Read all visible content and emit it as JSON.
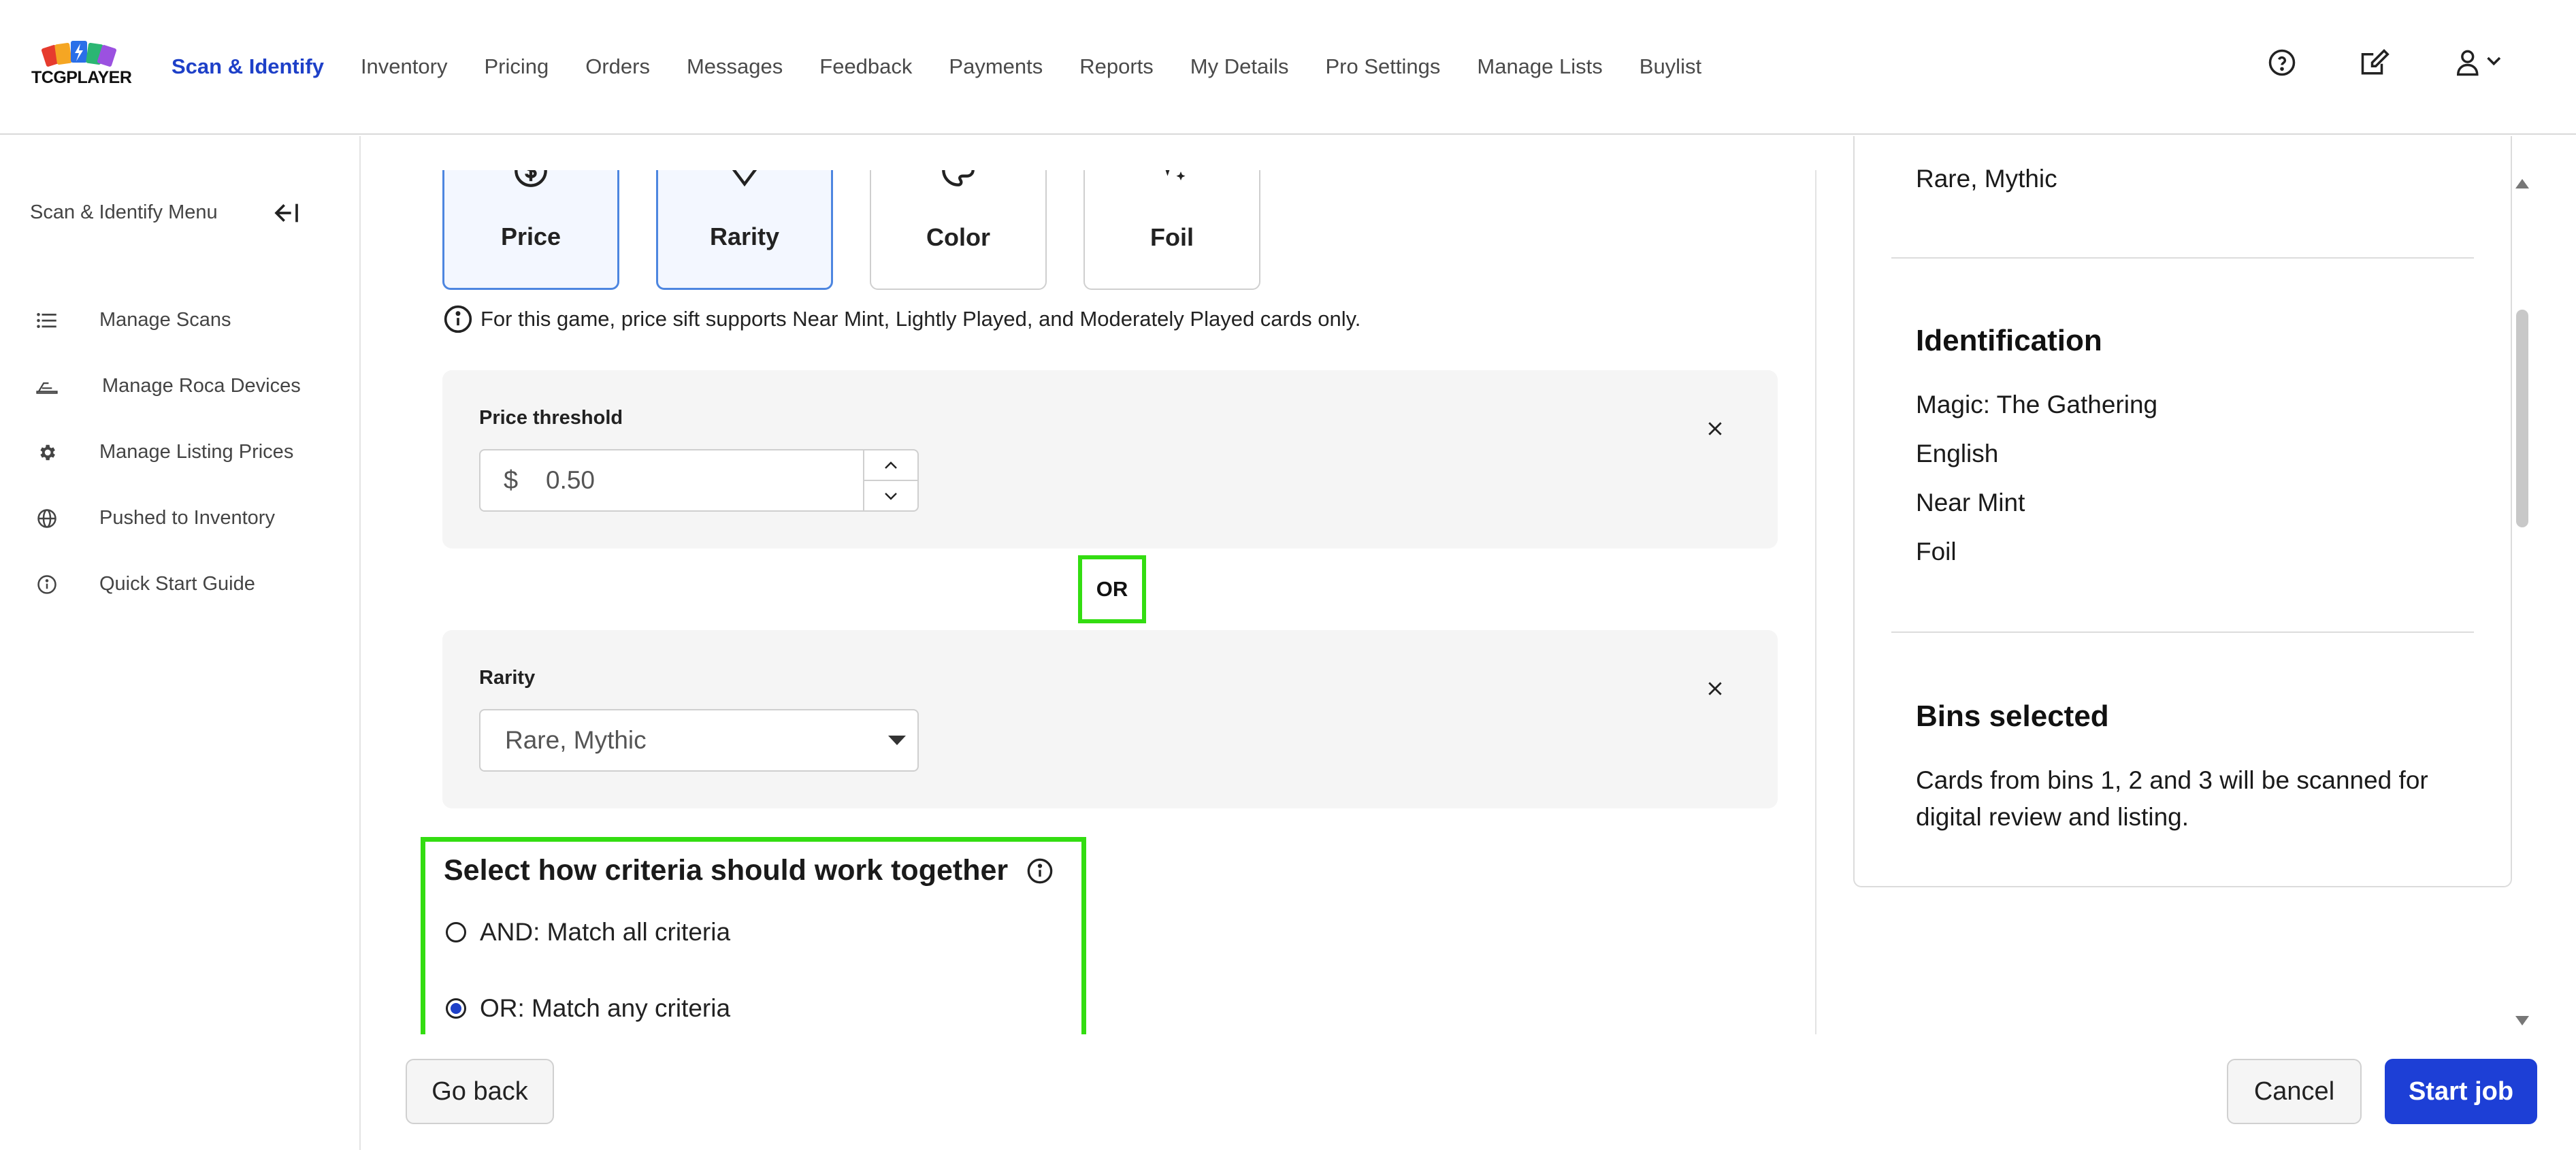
{
  "brand": {
    "name": "TCGPLAYER"
  },
  "nav": {
    "items": [
      {
        "label": "Scan & Identify",
        "active": true
      },
      {
        "label": "Inventory"
      },
      {
        "label": "Pricing"
      },
      {
        "label": "Orders"
      },
      {
        "label": "Messages"
      },
      {
        "label": "Feedback"
      },
      {
        "label": "Payments"
      },
      {
        "label": "Reports"
      },
      {
        "label": "My Details"
      },
      {
        "label": "Pro Settings"
      },
      {
        "label": "Manage Lists"
      },
      {
        "label": "Buylist"
      }
    ],
    "icons": [
      "help-circle-icon",
      "edit-note-icon",
      "user-account-icon"
    ]
  },
  "sidebar": {
    "title": "Scan & Identify Menu",
    "items": [
      {
        "label": "Manage Scans",
        "icon": "list-icon"
      },
      {
        "label": "Manage Roca Devices",
        "icon": "scanner-device-icon"
      },
      {
        "label": "Manage Listing Prices",
        "icon": "gear-icon"
      },
      {
        "label": "Pushed to Inventory",
        "icon": "globe-icon"
      },
      {
        "label": "Quick Start Guide",
        "icon": "info-icon"
      }
    ]
  },
  "criteria": {
    "tiles": [
      {
        "label": "Price",
        "selected": true,
        "icon": "dollar-coin-icon"
      },
      {
        "label": "Rarity",
        "selected": true,
        "icon": "diamond-icon"
      },
      {
        "label": "Color",
        "selected": false,
        "icon": "palette-icon"
      },
      {
        "label": "Foil",
        "selected": false,
        "icon": "sparkle-icon"
      }
    ],
    "info_text": "For this game, price sift supports Near Mint, Lightly Played, and Moderately Played cards only.",
    "price": {
      "label": "Price threshold",
      "currency": "$",
      "value": "0.50"
    },
    "connector": "OR",
    "rarity": {
      "label": "Rarity",
      "value": "Rare, Mythic"
    },
    "logic": {
      "title": "Select how criteria should work together",
      "options": [
        {
          "label": "AND: Match all criteria",
          "selected": false
        },
        {
          "label": "OR: Match any criteria",
          "selected": true
        }
      ]
    }
  },
  "summary": {
    "rarity_value": "Rare, Mythic",
    "identification": {
      "heading": "Identification",
      "lines": [
        "Magic: The Gathering",
        "English",
        "Near Mint",
        "Foil"
      ]
    },
    "bins": {
      "heading": "Bins selected",
      "text": "Cards from bins 1, 2 and 3 will be scanned for digital review and listing."
    }
  },
  "footer": {
    "back": "Go back",
    "cancel": "Cancel",
    "start": "Start job"
  },
  "colors": {
    "accent": "#1e40c8",
    "primary_button": "#1d3fd6",
    "highlight": "#33dd11",
    "selected_tile_bg": "#f3f7ff"
  }
}
